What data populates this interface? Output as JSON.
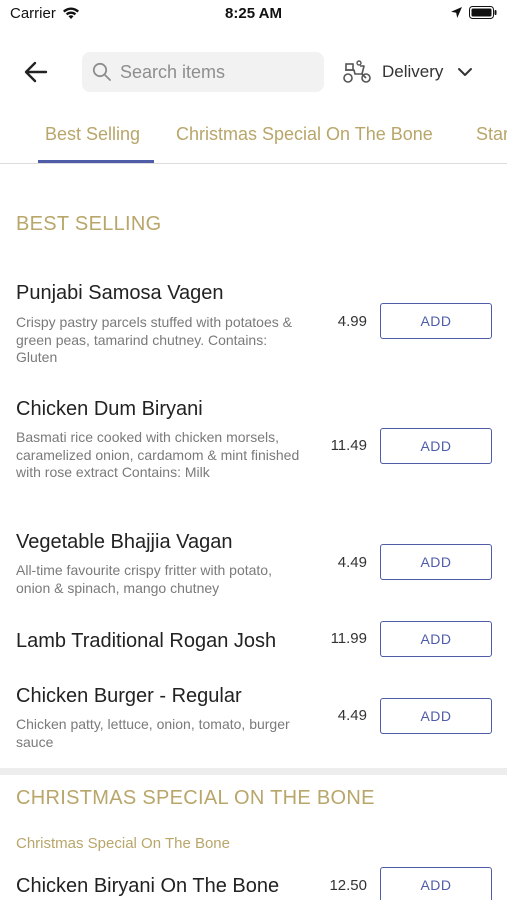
{
  "status_bar": {
    "carrier": "Carrier",
    "time": "8:25 AM"
  },
  "header": {
    "search": {
      "placeholder": "Search items",
      "value": ""
    },
    "delivery": {
      "label": "Delivery",
      "icon": "scooter-icon"
    }
  },
  "tabs": [
    {
      "label": "Best Selling",
      "active": true
    },
    {
      "label": "Christmas Special On The Bone",
      "active": false
    },
    {
      "label": "Star",
      "active": false
    }
  ],
  "sections": [
    {
      "title": "BEST SELLING",
      "items": [
        {
          "name": "Punjabi Samosa Vagen",
          "desc": "Crispy pastry parcels stuffed with potatoes & green peas, tamarind chutney.   Contains: Gluten",
          "price": "4.99",
          "button": "ADD"
        },
        {
          "name": "Chicken Dum Biryani",
          "desc": "Basmati rice cooked with chicken morsels, caramelized onion, cardamom & mint finished with rose extract Contains: Milk",
          "price": "11.49",
          "button": "ADD"
        },
        {
          "name": "Vegetable Bhajjia Vagan",
          "desc": "All-time favourite crispy fritter with potato, onion & spinach, mango chutney",
          "price": "4.49",
          "button": "ADD"
        },
        {
          "name": "Lamb Traditional Rogan Josh",
          "desc": "",
          "price": "11.99",
          "button": "ADD"
        },
        {
          "name": "Chicken Burger - Regular",
          "desc": "Chicken patty, lettuce, onion, tomato, burger sauce",
          "price": "4.49",
          "button": "ADD"
        }
      ]
    },
    {
      "title": "CHRISTMAS SPECIAL ON THE BONE",
      "subtitle": "Christmas Special On The Bone",
      "items": [
        {
          "name": "Chicken Biryani On The Bone",
          "price": "12.50",
          "button": "ADD"
        }
      ]
    }
  ],
  "colors": {
    "accent_gold": "#b8a66a",
    "accent_blue": "#4f5ca8"
  }
}
